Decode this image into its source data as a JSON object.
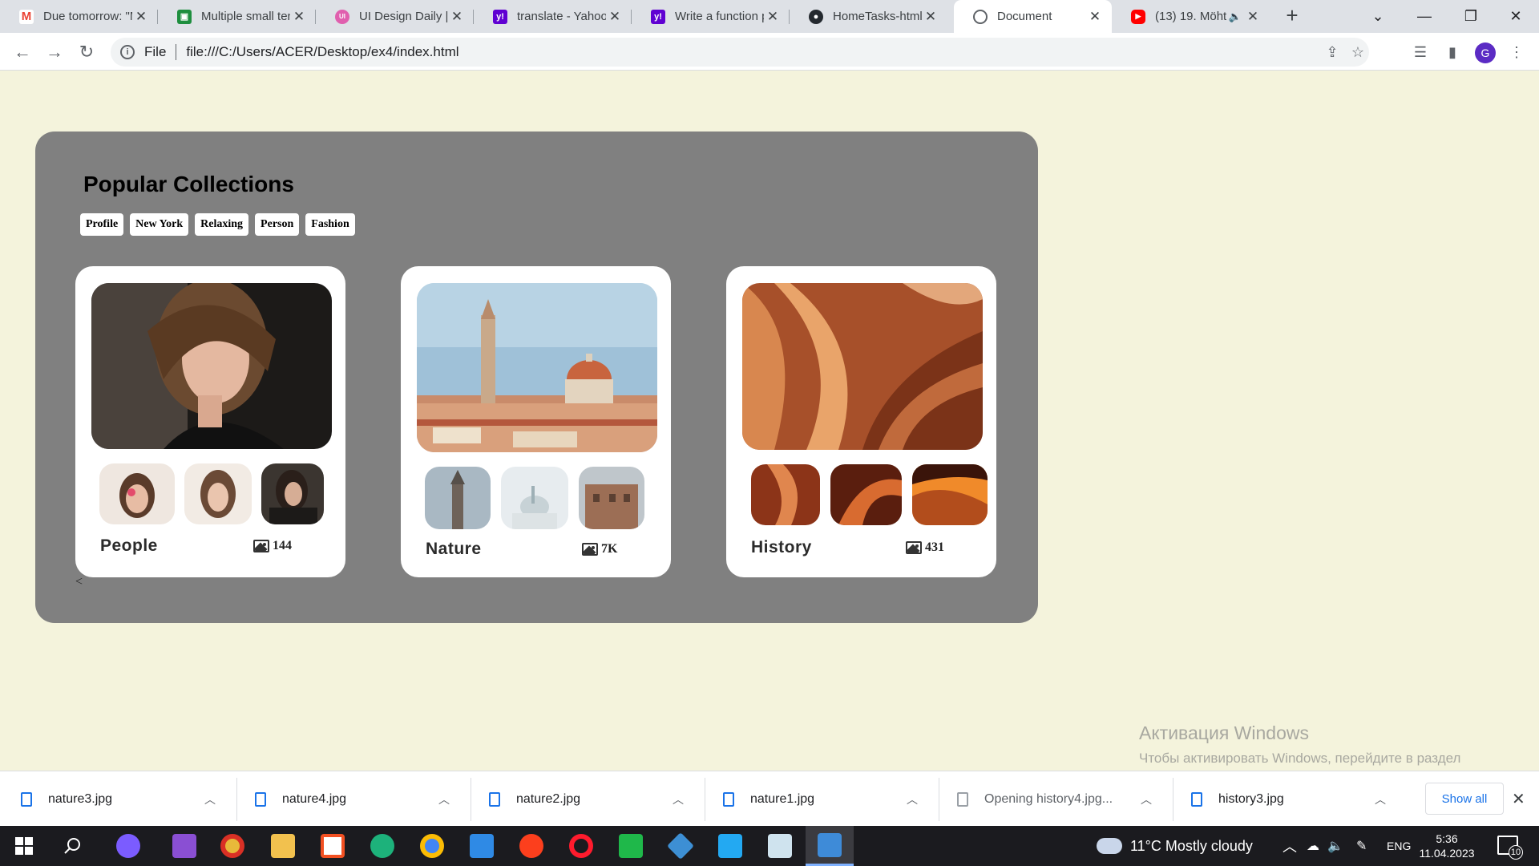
{
  "browser": {
    "tabs": [
      {
        "title": "Due tomorrow: \"M",
        "favicon": "gmail-icon",
        "color": "#ea4335",
        "glyph": "M"
      },
      {
        "title": "Multiple small ten",
        "favicon": "classroom-icon",
        "color": "#1e8e3e",
        "glyph": "▣"
      },
      {
        "title": "UI Design Daily | ",
        "favicon": "ui-design-daily-icon",
        "color": "#e05fae",
        "glyph": "UI"
      },
      {
        "title": "translate - Yahoo",
        "favicon": "yahoo-icon",
        "color": "#6001d2",
        "glyph": "y!"
      },
      {
        "title": "Write a function p",
        "favicon": "yahoo-icon",
        "color": "#6001d2",
        "glyph": "y!"
      },
      {
        "title": "HomeTasks-html-",
        "favicon": "github-icon",
        "color": "#24292f",
        "glyph": "●"
      },
      {
        "title": "Document",
        "favicon": "globe-icon",
        "color": "#5f6368",
        "glyph": "◍"
      },
      {
        "title": "(13) 19. Möht",
        "favicon": "youtube-icon",
        "color": "#ff0000",
        "glyph": "▶"
      }
    ],
    "active_tab": 6,
    "url_scheme": "File",
    "url": "file:///C:/Users/ACER/Desktop/ex4/index.html",
    "profile_initial": "G"
  },
  "page": {
    "title": "Popular Collections",
    "tags": [
      "Profile",
      "New York",
      "Relaxing",
      "Person",
      "Fashion"
    ],
    "back_arrow": "<",
    "collections": [
      {
        "label": "People",
        "count": "144"
      },
      {
        "label": "Nature",
        "count": "7K"
      },
      {
        "label": "History",
        "count": "431"
      }
    ]
  },
  "watermark": {
    "line1": "Активация Windows",
    "line2": "Чтобы активировать Windows, перейдите в раздел \"Параметры\"."
  },
  "downloads": {
    "items": [
      {
        "name": "nature3.jpg",
        "pending": false
      },
      {
        "name": "nature4.jpg",
        "pending": false
      },
      {
        "name": "nature2.jpg",
        "pending": false
      },
      {
        "name": "nature1.jpg",
        "pending": false
      },
      {
        "name": "Opening history4.jpg...",
        "pending": true
      },
      {
        "name": "history3.jpg",
        "pending": false
      }
    ],
    "show_all": "Show all"
  },
  "taskbar": {
    "weather": "11°C  Mostly cloudy",
    "language": "ENG",
    "time": "5:36",
    "date": "11.04.2023",
    "notifications": "10"
  }
}
